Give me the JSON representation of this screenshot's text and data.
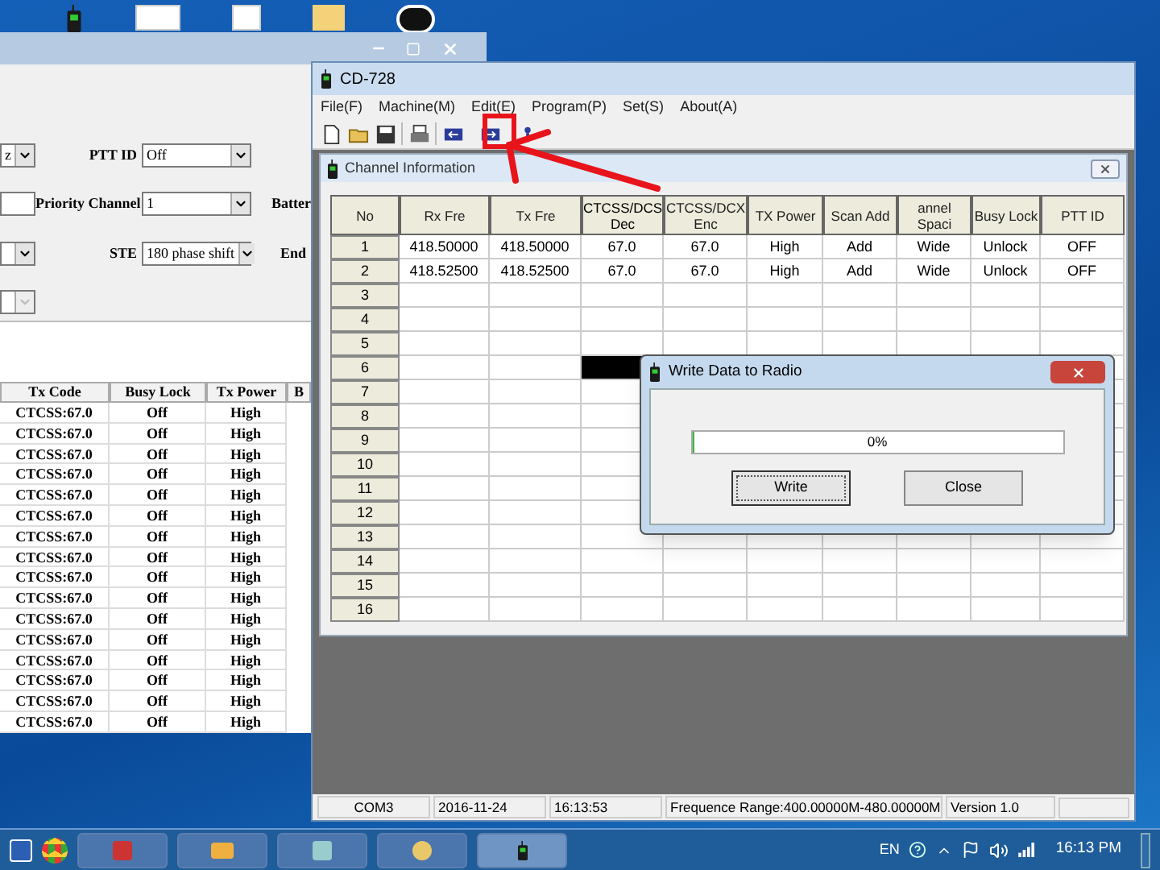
{
  "background_window": {
    "form": {
      "unit_field": {
        "value": "z"
      },
      "ptt_id": {
        "label": "PTT ID",
        "value": "Off"
      },
      "priority_channel": {
        "label": "Priority Channel",
        "value": "1"
      },
      "battery_label": "Batter",
      "ste": {
        "label": "STE",
        "value": "180 phase shift"
      },
      "end_label": "End",
      "lower_field": {
        "disabled": true
      }
    },
    "table": {
      "columns": [
        "Tx Code",
        "Busy Lock",
        "Tx Power",
        "B"
      ],
      "rows": [
        [
          "CTCSS:67.0",
          "Off",
          "High"
        ],
        [
          "CTCSS:67.0",
          "Off",
          "High"
        ],
        [
          "CTCSS:67.0",
          "Off",
          "High"
        ],
        [
          "CTCSS:67.0",
          "Off",
          "High"
        ],
        [
          "CTCSS:67.0",
          "Off",
          "High"
        ],
        [
          "CTCSS:67.0",
          "Off",
          "High"
        ],
        [
          "CTCSS:67.0",
          "Off",
          "High"
        ],
        [
          "CTCSS:67.0",
          "Off",
          "High"
        ],
        [
          "CTCSS:67.0",
          "Off",
          "High"
        ],
        [
          "CTCSS:67.0",
          "Off",
          "High"
        ],
        [
          "CTCSS:67.0",
          "Off",
          "High"
        ],
        [
          "CTCSS:67.0",
          "Off",
          "High"
        ],
        [
          "CTCSS:67.0",
          "Off",
          "High"
        ],
        [
          "CTCSS:67.0",
          "Off",
          "High"
        ],
        [
          "CTCSS:67.0",
          "Off",
          "High"
        ],
        [
          "CTCSS:67.0",
          "Off",
          "High"
        ]
      ]
    }
  },
  "window": {
    "title": "CD-728"
  },
  "menu": [
    "File(F)",
    "Machine(M)",
    "Edit(E)",
    "Program(P)",
    "Set(S)",
    "About(A)"
  ],
  "child_window": {
    "title": "Channel Information"
  },
  "table": {
    "columns": [
      {
        "label": "No",
        "selected": false
      },
      {
        "label": "Rx Fre",
        "selected": false
      },
      {
        "label": "Tx Fre",
        "selected": false
      },
      {
        "label": "CTCSS/DCS Dec",
        "selected": true
      },
      {
        "label": "CTCSS/DCX Enc",
        "selected": false
      },
      {
        "label": "TX Power",
        "selected": false
      },
      {
        "label": "Scan Add",
        "selected": false
      },
      {
        "label": "annel Spaci",
        "selected": false
      },
      {
        "label": "Busy Lock",
        "selected": false
      },
      {
        "label": "PTT ID",
        "selected": false
      }
    ],
    "rows": [
      {
        "no": "1",
        "selected": false,
        "values": [
          "418.50000",
          "418.50000",
          "67.0",
          "67.0",
          "High",
          "Add",
          "Wide",
          "Unlock",
          "OFF"
        ]
      },
      {
        "no": "2",
        "selected": false,
        "values": [
          "418.52500",
          "418.52500",
          "67.0",
          "67.0",
          "High",
          "Add",
          "Wide",
          "Unlock",
          "OFF"
        ]
      },
      {
        "no": "3",
        "selected": false
      },
      {
        "no": "4",
        "selected": false
      },
      {
        "no": "5",
        "selected": false
      },
      {
        "no": "6",
        "selected": true
      },
      {
        "no": "7",
        "selected": false
      },
      {
        "no": "8",
        "selected": false
      },
      {
        "no": "9",
        "selected": false
      },
      {
        "no": "10",
        "selected": false
      },
      {
        "no": "11",
        "selected": false
      },
      {
        "no": "12",
        "selected": false
      },
      {
        "no": "13",
        "selected": false
      },
      {
        "no": "14",
        "selected": false
      },
      {
        "no": "15",
        "selected": false
      },
      {
        "no": "16",
        "selected": false
      }
    ]
  },
  "dialog": {
    "title": "Write Data to Radio",
    "progress": {
      "level": 0,
      "reading": "0%"
    },
    "buttons": [
      {
        "label": "Write",
        "focused": true
      },
      {
        "label": "Close",
        "focused": false
      }
    ]
  },
  "status_bar": [
    "COM3",
    "2016-11-24",
    "16:13:53",
    "Frequence Range:400.00000M-480.00000M",
    "Version 1.0"
  ],
  "taskbar": {
    "language": "EN",
    "clock": "16:13 PM"
  }
}
